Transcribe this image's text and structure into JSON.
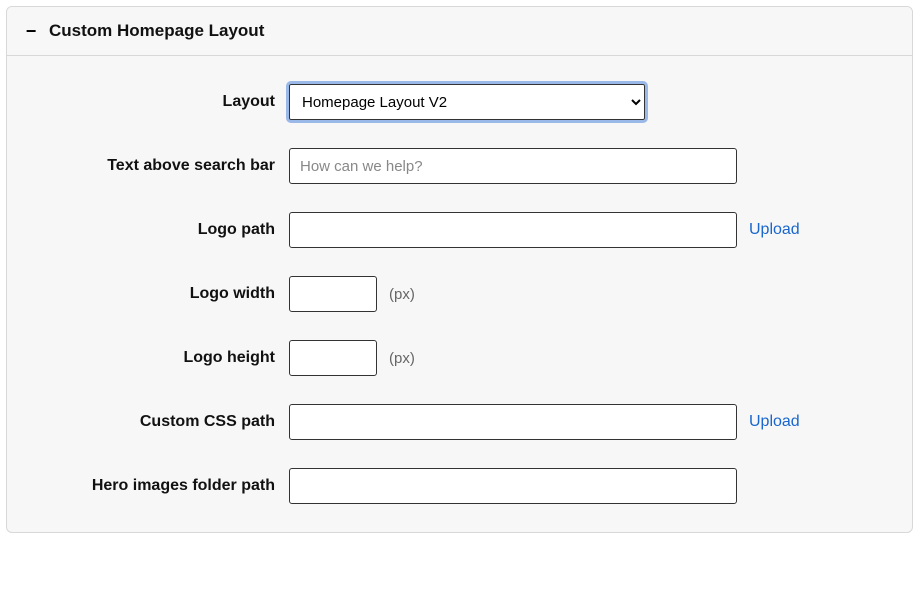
{
  "panel": {
    "title": "Custom Homepage Layout",
    "collapse_icon": "−"
  },
  "fields": {
    "layout": {
      "label": "Layout",
      "value": "Homepage Layout V2"
    },
    "text_above_search": {
      "label": "Text above search bar",
      "placeholder": "How can we help?",
      "value": ""
    },
    "logo_path": {
      "label": "Logo path",
      "value": "",
      "upload_label": "Upload"
    },
    "logo_width": {
      "label": "Logo width",
      "value": "",
      "unit": "(px)"
    },
    "logo_height": {
      "label": "Logo height",
      "value": "",
      "unit": "(px)"
    },
    "custom_css_path": {
      "label": "Custom CSS path",
      "value": "",
      "upload_label": "Upload"
    },
    "hero_images_folder": {
      "label": "Hero images folder path",
      "value": ""
    }
  }
}
